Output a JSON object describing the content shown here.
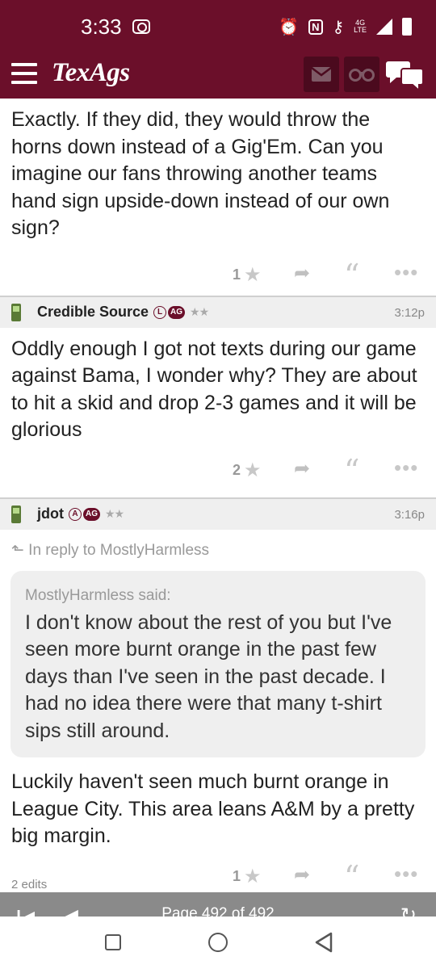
{
  "status_bar": {
    "time": "3:33",
    "network": "4G LTE"
  },
  "app": {
    "logo": "TexAgs",
    "brand_color": "#6b0f2a"
  },
  "posts": [
    {
      "body": "Exactly. If they did, they would throw the horns down instead of a Gig'Em. Can you imagine our fans throwing another teams hand sign upside-down instead of our own sign?",
      "likes": "1"
    },
    {
      "username": "Credible Source",
      "badge_letter": "L",
      "badge_ag": "AG",
      "stars": "★★",
      "time": "3:12p",
      "body": "Oddly enough I got not texts during our game against Bama, I wonder why? They are about to hit a skid and drop 2-3 games and it will be glorious",
      "likes": "2"
    },
    {
      "username": "jdot",
      "badge_letter": "A",
      "badge_ag": "AG",
      "stars": "★★",
      "time": "3:16p",
      "reply_to": "In reply to MostlyHarmless",
      "quote_author": "MostlyHarmless said:",
      "quote_text": "I don't know about the rest of you but I've seen more burnt orange in the past few days than I've seen in the past decade. I had no idea there were that many t-shirt sips still around.",
      "body": "Luckily haven't seen much burnt orange in League City. This area leans A&M by a pretty big margin.",
      "likes": "1",
      "edits": "2 edits"
    }
  ],
  "pagination": {
    "label": "Page 492 of 492"
  }
}
